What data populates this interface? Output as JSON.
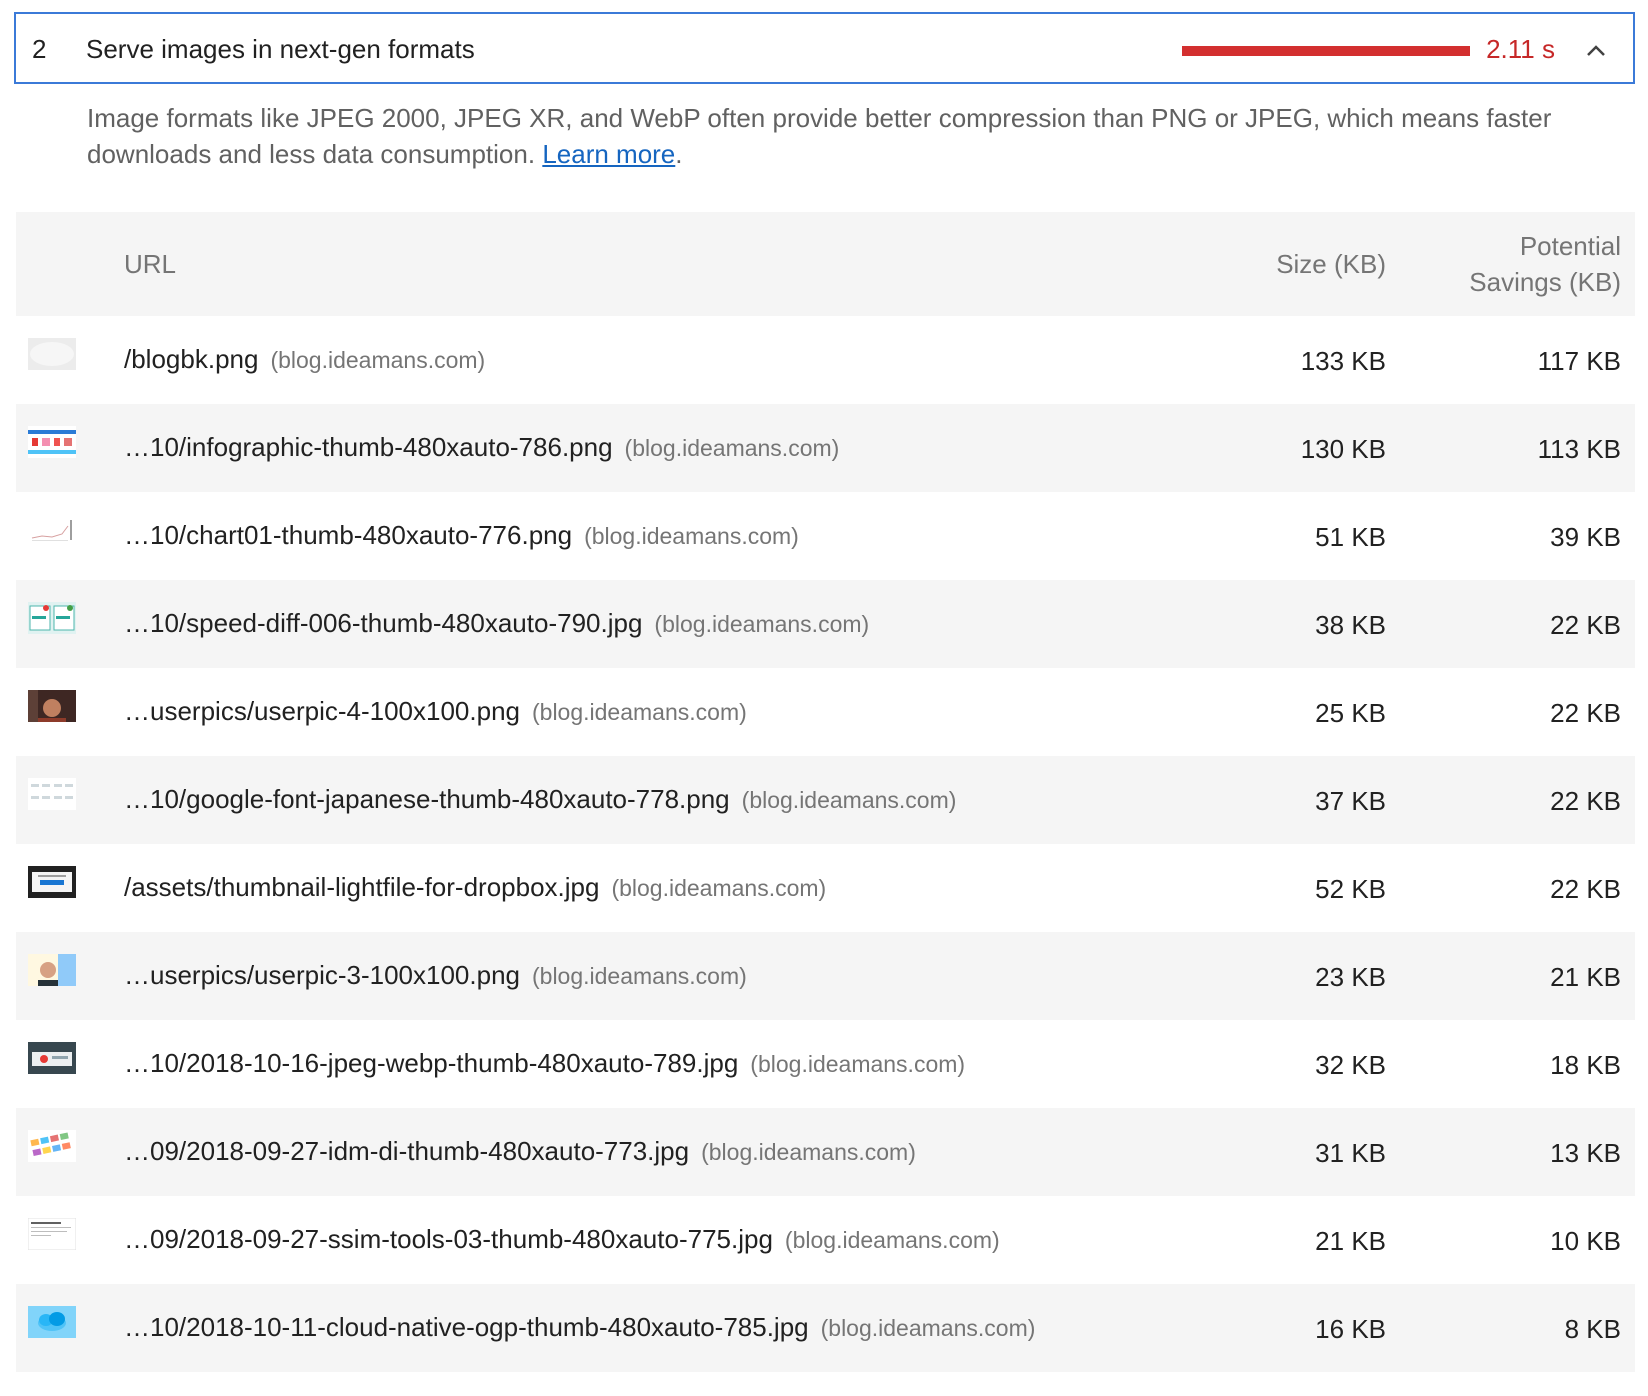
{
  "audit": {
    "index": "2",
    "title": "Serve images in next-gen formats",
    "value": "2.11 s",
    "description_text": "Image formats like JPEG 2000, JPEG XR, and WebP often provide better compression than PNG or JPEG, which means faster downloads and less data consumption.",
    "learn_more": "Learn more",
    "description_end": ".",
    "colors": {
      "border": "#3b7ad8",
      "bar": "#d32f2f",
      "value": "#c62828",
      "link": "#1565c0"
    }
  },
  "table": {
    "headers": {
      "url": "URL",
      "size": "Size (KB)",
      "savings_line1": "Potential",
      "savings_line2": "Savings (KB)"
    },
    "rows": [
      {
        "url": "/blogbk.png",
        "host": "(blog.ideamans.com)",
        "size": "133 KB",
        "savings": "117 KB"
      },
      {
        "url": "…10/infographic-thumb-480xauto-786.png",
        "host": "(blog.ideamans.com)",
        "size": "130 KB",
        "savings": "113 KB"
      },
      {
        "url": "…10/chart01-thumb-480xauto-776.png",
        "host": "(blog.ideamans.com)",
        "size": "51 KB",
        "savings": "39 KB"
      },
      {
        "url": "…10/speed-diff-006-thumb-480xauto-790.jpg",
        "host": "(blog.ideamans.com)",
        "size": "38 KB",
        "savings": "22 KB"
      },
      {
        "url": "…userpics/userpic-4-100x100.png",
        "host": "(blog.ideamans.com)",
        "size": "25 KB",
        "savings": "22 KB"
      },
      {
        "url": "…10/google-font-japanese-thumb-480xauto-778.png",
        "host": "(blog.ideamans.com)",
        "size": "37 KB",
        "savings": "22 KB"
      },
      {
        "url": "/assets/thumbnail-lightfile-for-dropbox.jpg",
        "host": "(blog.ideamans.com)",
        "size": "52 KB",
        "savings": "22 KB"
      },
      {
        "url": "…userpics/userpic-3-100x100.png",
        "host": "(blog.ideamans.com)",
        "size": "23 KB",
        "savings": "21 KB"
      },
      {
        "url": "…10/2018-10-16-jpeg-webp-thumb-480xauto-789.jpg",
        "host": "(blog.ideamans.com)",
        "size": "32 KB",
        "savings": "18 KB"
      },
      {
        "url": "…09/2018-09-27-idm-di-thumb-480xauto-773.jpg",
        "host": "(blog.ideamans.com)",
        "size": "31 KB",
        "savings": "13 KB"
      },
      {
        "url": "…09/2018-09-27-ssim-tools-03-thumb-480xauto-775.jpg",
        "host": "(blog.ideamans.com)",
        "size": "21 KB",
        "savings": "10 KB"
      },
      {
        "url": "…10/2018-10-11-cloud-native-ogp-thumb-480xauto-785.jpg",
        "host": "(blog.ideamans.com)",
        "size": "16 KB",
        "savings": "8 KB"
      }
    ]
  }
}
